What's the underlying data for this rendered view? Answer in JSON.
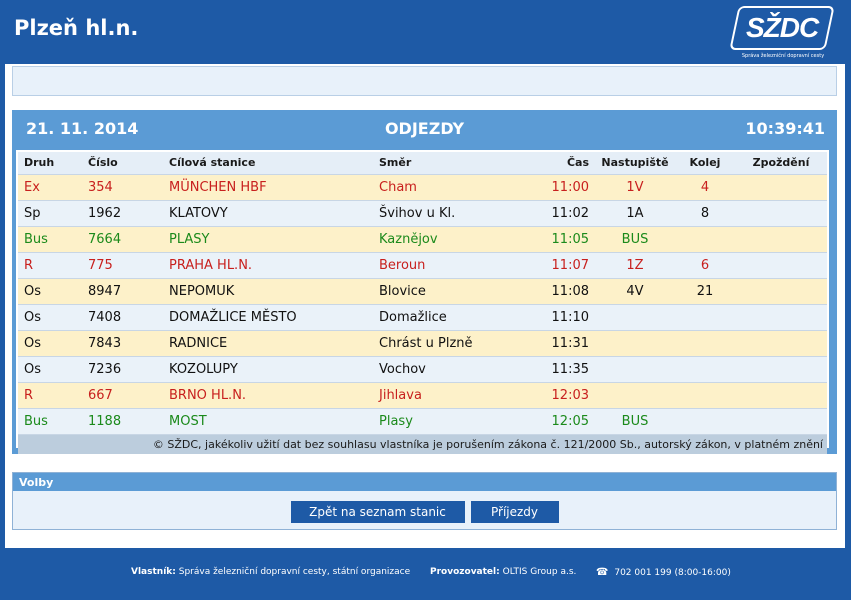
{
  "header": {
    "station": "Plzeň hl.n.",
    "logo_text": "SŽDC",
    "logo_subtitle": "Správa železniční dopravní cesty"
  },
  "board": {
    "date": "21. 11. 2014",
    "title": "ODJEZDY",
    "time": "10:39:41",
    "columns": [
      "Druh",
      "Číslo",
      "Cílová stanice",
      "Směr",
      "Čas",
      "Nastupiště",
      "Kolej",
      "Zpoždění"
    ],
    "rows": [
      {
        "type": "Ex",
        "number": "354",
        "destination": "MÜNCHEN HBF",
        "via": "Cham",
        "time": "11:00",
        "platform": "1V",
        "track": "4",
        "delay": "",
        "color": "red"
      },
      {
        "type": "Sp",
        "number": "1962",
        "destination": "KLATOVY",
        "via": "Švihov u Kl.",
        "time": "11:02",
        "platform": "1A",
        "track": "8",
        "delay": "",
        "color": "black"
      },
      {
        "type": "Bus",
        "number": "7664",
        "destination": "PLASY",
        "via": "Kaznějov",
        "time": "11:05",
        "platform": "BUS",
        "track": "",
        "delay": "",
        "color": "green"
      },
      {
        "type": "R",
        "number": "775",
        "destination": "PRAHA HL.N.",
        "via": "Beroun",
        "time": "11:07",
        "platform": "1Z",
        "track": "6",
        "delay": "",
        "color": "red"
      },
      {
        "type": "Os",
        "number": "8947",
        "destination": "NEPOMUK",
        "via": "Blovice",
        "time": "11:08",
        "platform": "4V",
        "track": "21",
        "delay": "",
        "color": "black"
      },
      {
        "type": "Os",
        "number": "7408",
        "destination": "DOMAŽLICE MĚSTO",
        "via": "Domažlice",
        "time": "11:10",
        "platform": "",
        "track": "",
        "delay": "",
        "color": "black"
      },
      {
        "type": "Os",
        "number": "7843",
        "destination": "RADNICE",
        "via": "Chrást u Plzně",
        "time": "11:31",
        "platform": "",
        "track": "",
        "delay": "",
        "color": "black"
      },
      {
        "type": "Os",
        "number": "7236",
        "destination": "KOZOLUPY",
        "via": "Vochov",
        "time": "11:35",
        "platform": "",
        "track": "",
        "delay": "",
        "color": "black"
      },
      {
        "type": "R",
        "number": "667",
        "destination": "BRNO HL.N.",
        "via": "Jihlava",
        "time": "12:03",
        "platform": "",
        "track": "",
        "delay": "",
        "color": "red"
      },
      {
        "type": "Bus",
        "number": "1188",
        "destination": "MOST",
        "via": "Plasy",
        "time": "12:05",
        "platform": "BUS",
        "track": "",
        "delay": "",
        "color": "green"
      }
    ],
    "copyright": "© SŽDC, jakékoliv užití dat bez souhlasu vlastníka je porušením zákona č. 121/2000 Sb., autorský zákon, v platném znění"
  },
  "volby": {
    "title": "Volby",
    "back_button": "Zpět na seznam stanic",
    "arrivals_button": "Příjezdy"
  },
  "footer": {
    "owner_label": "Vlastník:",
    "owner_value": "Správa železniční dopravní cesty, státní organizace",
    "operator_label": "Provozovatel:",
    "operator_value": "OLTIS Group a.s.",
    "phone": "702 001 199 (8:00-16:00)"
  },
  "colors": {
    "brand_blue": "#1e5aa6",
    "board_blue": "#5b9bd5",
    "row_yellow": "#fdf1c9",
    "row_blue": "#eaf2f9",
    "text_red": "#c8201e",
    "text_green": "#1b8a1b"
  },
  "icons": {
    "phone": "phone-icon"
  }
}
